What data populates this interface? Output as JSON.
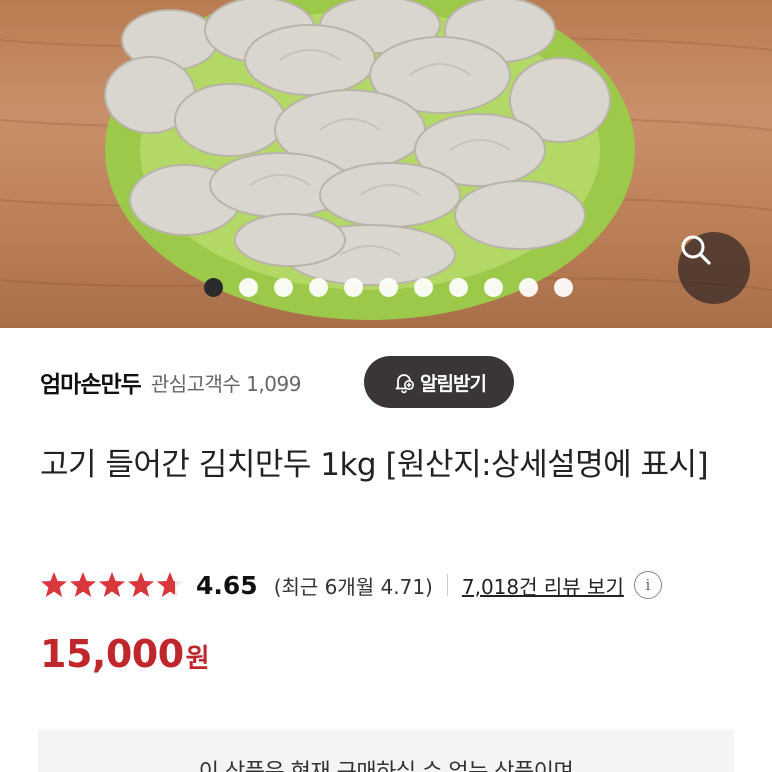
{
  "product_image": {
    "carousel_total": 11,
    "carousel_active_index": 0
  },
  "store": {
    "name": "엄마손만두",
    "fans": "관심고객수 1,099",
    "notify_label": "알림받기"
  },
  "product": {
    "title": "고기 들어간 김치만두 1kg [원산지:상세설명에 표시]",
    "rating": "4.65",
    "rating_value": 4.65,
    "recent_rating": "(최근 6개월 4.71)",
    "reviews_link": "7,018건 리뷰 보기",
    "price": "15,000",
    "price_unit": "원"
  },
  "notice": {
    "text": "이 상품은 현재 구매하실 수 없는 상품이며"
  },
  "colors": {
    "star": "#d9373b",
    "price": "#c0272d",
    "button_bg": "#3b3636"
  },
  "icons": {
    "search": "magnifier",
    "notify": "bell-plus",
    "info": "info-circle"
  }
}
